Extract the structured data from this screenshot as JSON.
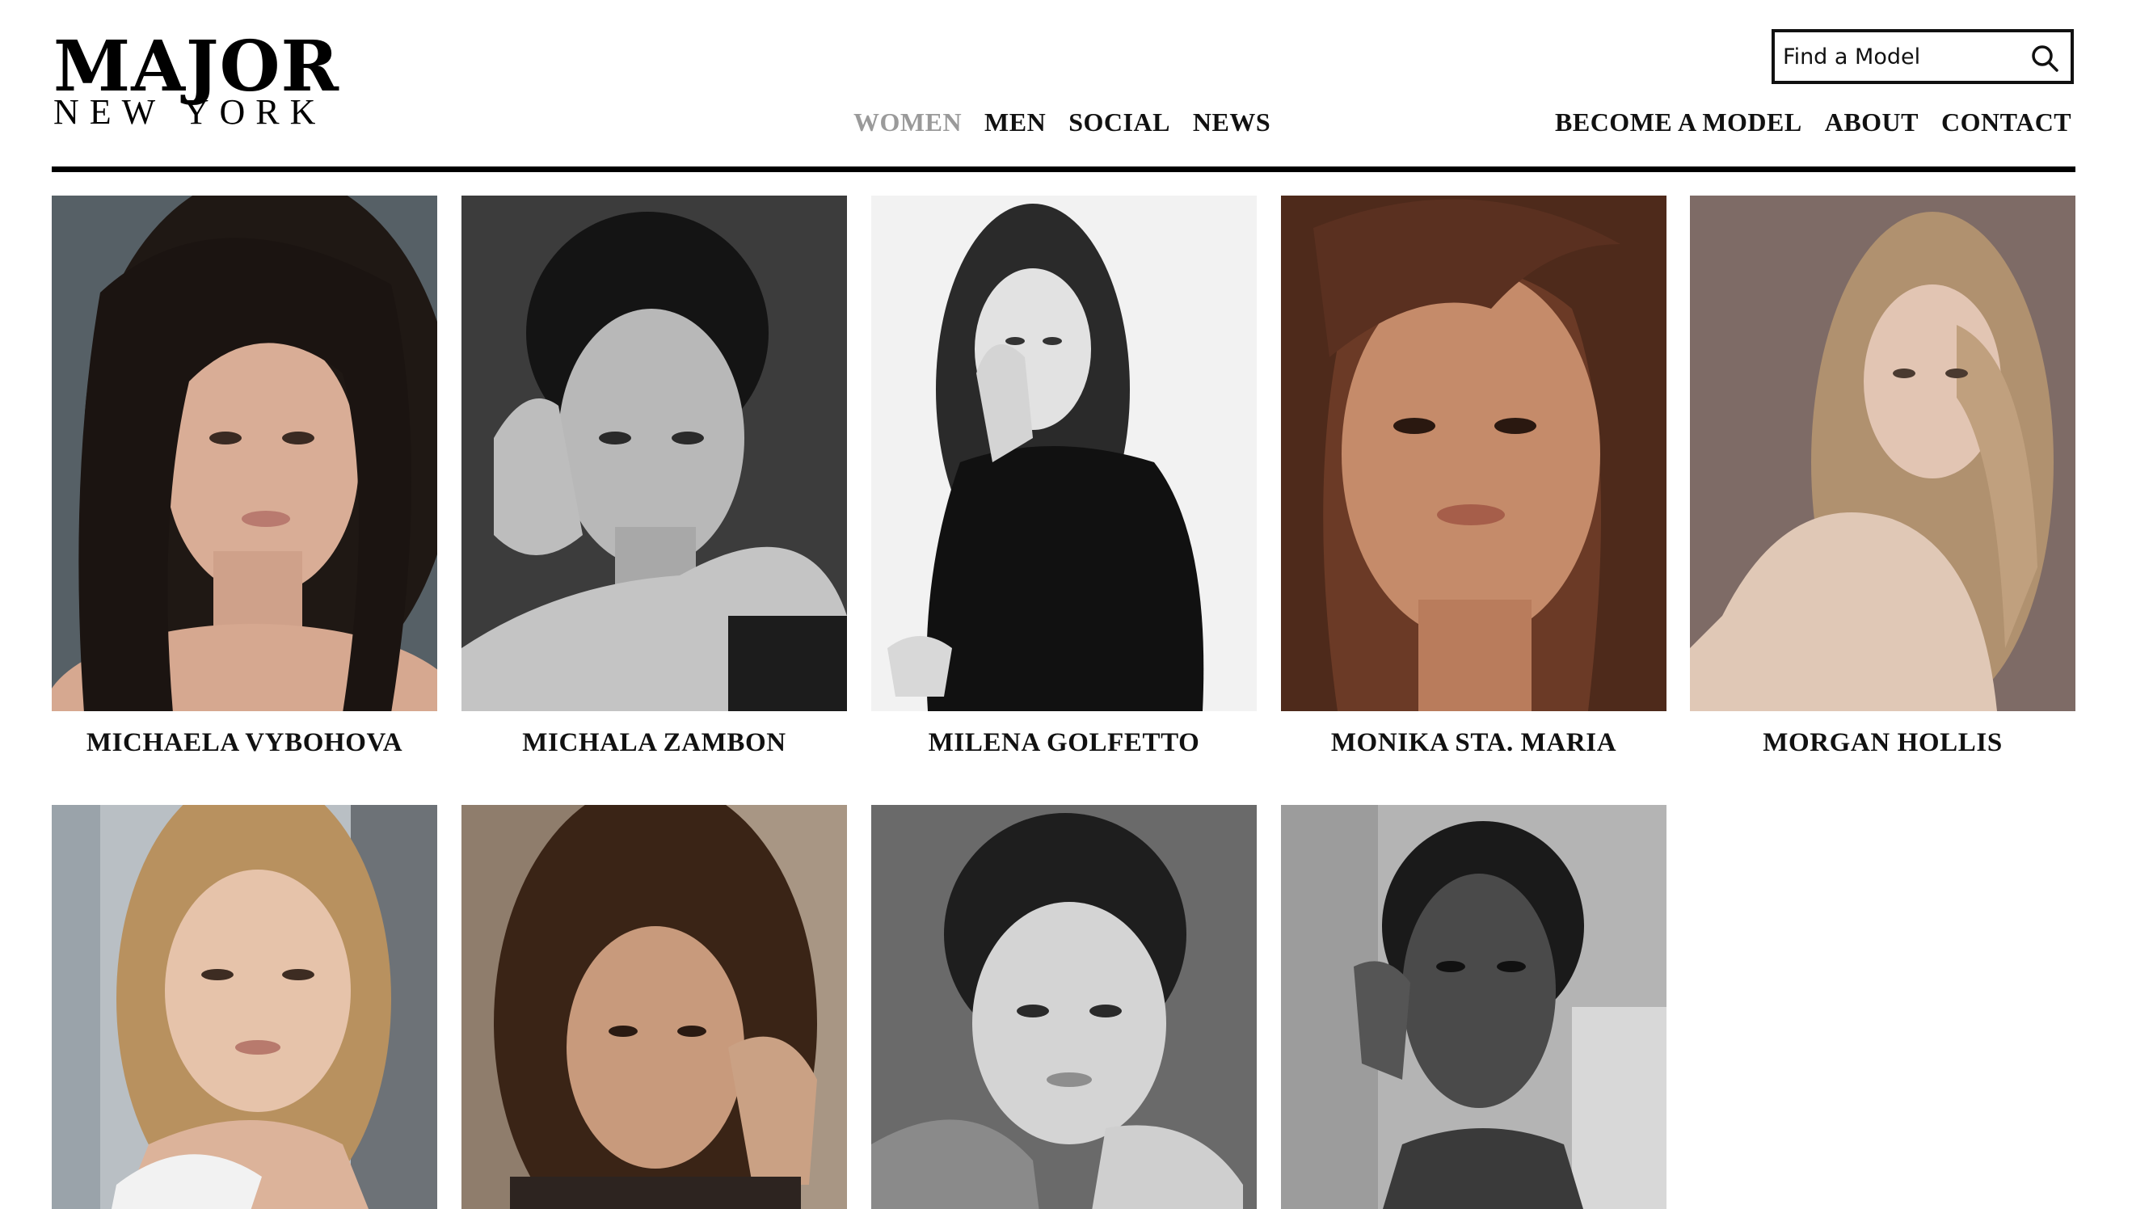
{
  "brand": {
    "line1": "MAJOR",
    "line2": "NEW YORK"
  },
  "search": {
    "placeholder": "Find a Model",
    "icon": "search-icon"
  },
  "nav_main": [
    {
      "label": "WOMEN",
      "active": true
    },
    {
      "label": "MEN",
      "active": false
    },
    {
      "label": "SOCIAL",
      "active": false
    },
    {
      "label": "NEWS",
      "active": false
    }
  ],
  "nav_secondary": [
    {
      "label": "BECOME A MODEL"
    },
    {
      "label": "ABOUT"
    },
    {
      "label": "CONTACT"
    }
  ],
  "colors": {
    "nav_active": "#9a9a9a",
    "text": "#111111",
    "rule": "#000000"
  },
  "models": [
    {
      "name": "MICHAELA VYBOHOVA",
      "photo_tone": "color",
      "bg": "#5e6a70"
    },
    {
      "name": "MICHALA ZAMBON",
      "photo_tone": "black-and-white",
      "bg": "#3c3c3c"
    },
    {
      "name": "MILENA GOLFETTO",
      "photo_tone": "black-and-white",
      "bg": "#f2f2f2"
    },
    {
      "name": "MONIKA STA. MARIA",
      "photo_tone": "color",
      "bg": "#6b3a26"
    },
    {
      "name": "MORGAN HOLLIS",
      "photo_tone": "color",
      "bg": "#7e6b66"
    },
    {
      "name": "",
      "photo_tone": "color",
      "bg": "#b9bfc4"
    },
    {
      "name": "",
      "photo_tone": "color",
      "bg": "#8f7d6c"
    },
    {
      "name": "",
      "photo_tone": "black-and-white",
      "bg": "#6a6a6a"
    },
    {
      "name": "",
      "photo_tone": "black-and-white",
      "bg": "#b4b4b4"
    }
  ]
}
